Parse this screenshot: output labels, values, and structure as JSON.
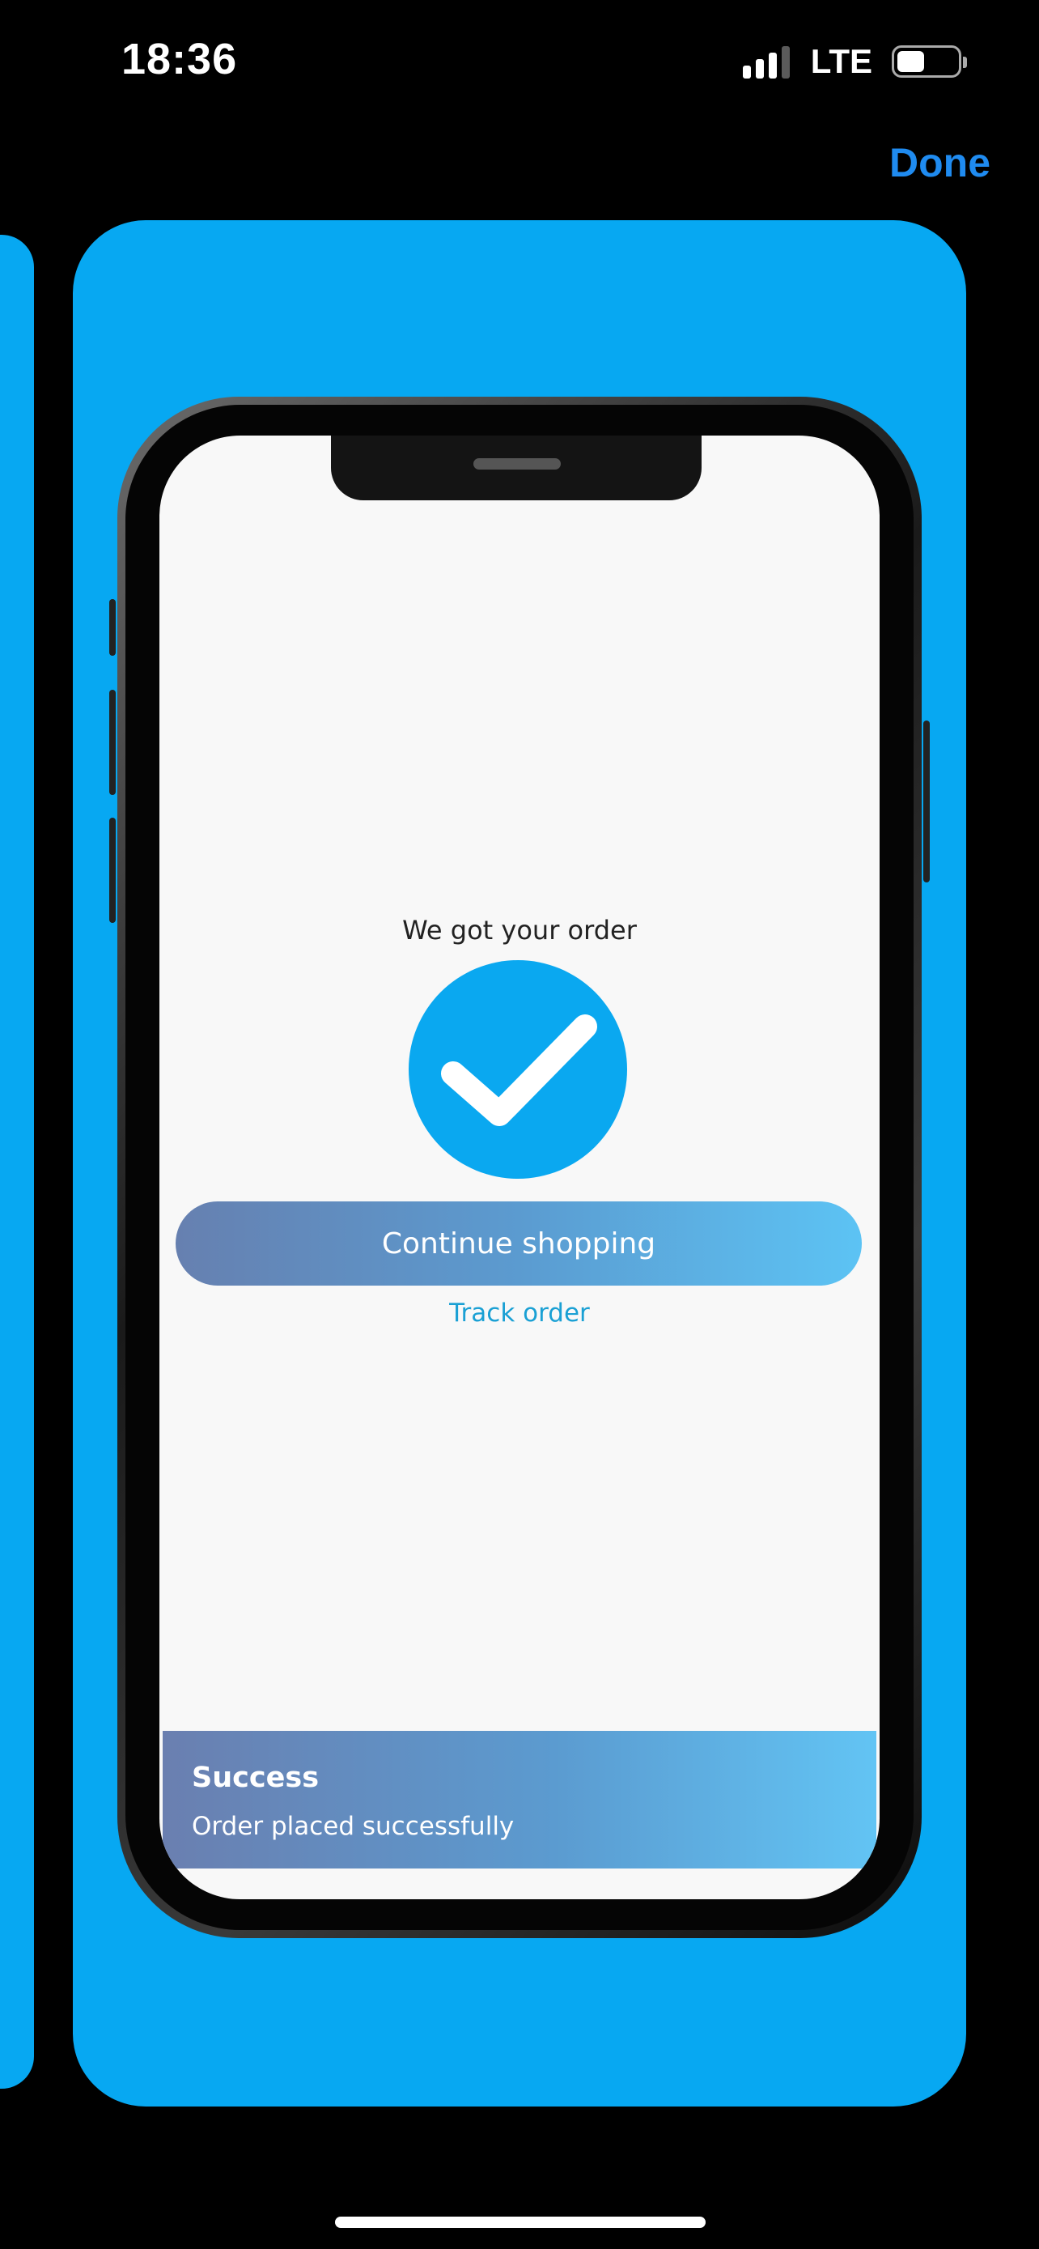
{
  "status_bar": {
    "time": "18:36",
    "network": "LTE",
    "battery_level_percent": 46
  },
  "toolbar": {
    "done_label": "Done"
  },
  "preview": {
    "background_color": "#07a8f2",
    "order_confirmation": {
      "heading": "We got your order",
      "icon": "checkmark-icon",
      "continue_label": "Continue shopping",
      "track_label": "Track order"
    },
    "toast": {
      "title": "Success",
      "message": "Order placed successfully"
    }
  }
}
